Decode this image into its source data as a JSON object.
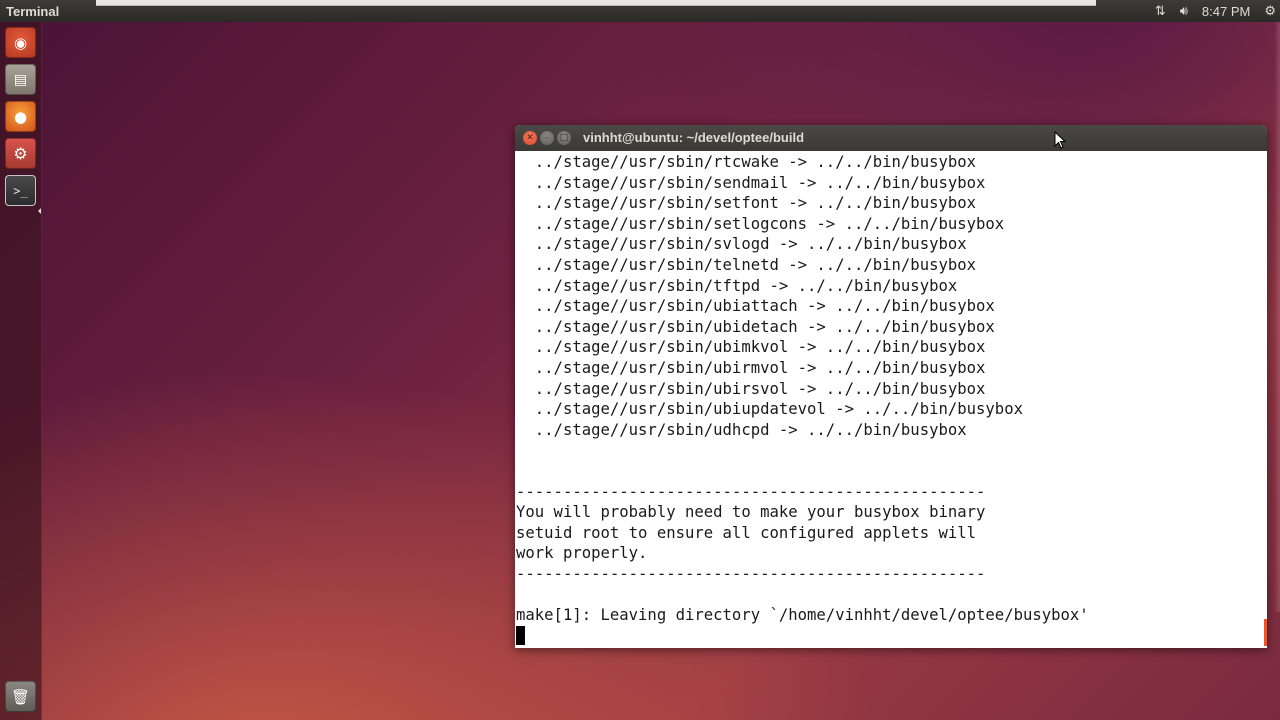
{
  "top_panel": {
    "app_title": "Terminal",
    "clock": "8:47 PM"
  },
  "launcher": {
    "items": [
      {
        "name": "dash-home",
        "icon": "ubuntu-dash-icon"
      },
      {
        "name": "files",
        "icon": "file-manager-icon"
      },
      {
        "name": "firefox",
        "icon": "firefox-icon"
      },
      {
        "name": "system-settings",
        "icon": "settings-icon"
      },
      {
        "name": "terminal",
        "icon": "terminal-icon"
      },
      {
        "name": "trash",
        "icon": "trash-icon"
      }
    ]
  },
  "terminal": {
    "window_title": "vinhht@ubuntu: ~/devel/optee/build",
    "lines": [
      "  ../stage//usr/sbin/rtcwake -> ../../bin/busybox",
      "  ../stage//usr/sbin/sendmail -> ../../bin/busybox",
      "  ../stage//usr/sbin/setfont -> ../../bin/busybox",
      "  ../stage//usr/sbin/setlogcons -> ../../bin/busybox",
      "  ../stage//usr/sbin/svlogd -> ../../bin/busybox",
      "  ../stage//usr/sbin/telnetd -> ../../bin/busybox",
      "  ../stage//usr/sbin/tftpd -> ../../bin/busybox",
      "  ../stage//usr/sbin/ubiattach -> ../../bin/busybox",
      "  ../stage//usr/sbin/ubidetach -> ../../bin/busybox",
      "  ../stage//usr/sbin/ubimkvol -> ../../bin/busybox",
      "  ../stage//usr/sbin/ubirmvol -> ../../bin/busybox",
      "  ../stage//usr/sbin/ubirsvol -> ../../bin/busybox",
      "  ../stage//usr/sbin/ubiupdatevol -> ../../bin/busybox",
      "  ../stage//usr/sbin/udhcpd -> ../../bin/busybox",
      "",
      "",
      "--------------------------------------------------",
      "You will probably need to make your busybox binary",
      "setuid root to ensure all configured applets will",
      "work properly.",
      "--------------------------------------------------",
      "",
      "make[1]: Leaving directory `/home/vinhht/devel/optee/busybox'"
    ]
  },
  "colors": {
    "panel_bg": "#3c3b37",
    "close_button": "#e0563a",
    "terminal_bg": "#ffffff",
    "terminal_fg": "#1a1a1a"
  }
}
